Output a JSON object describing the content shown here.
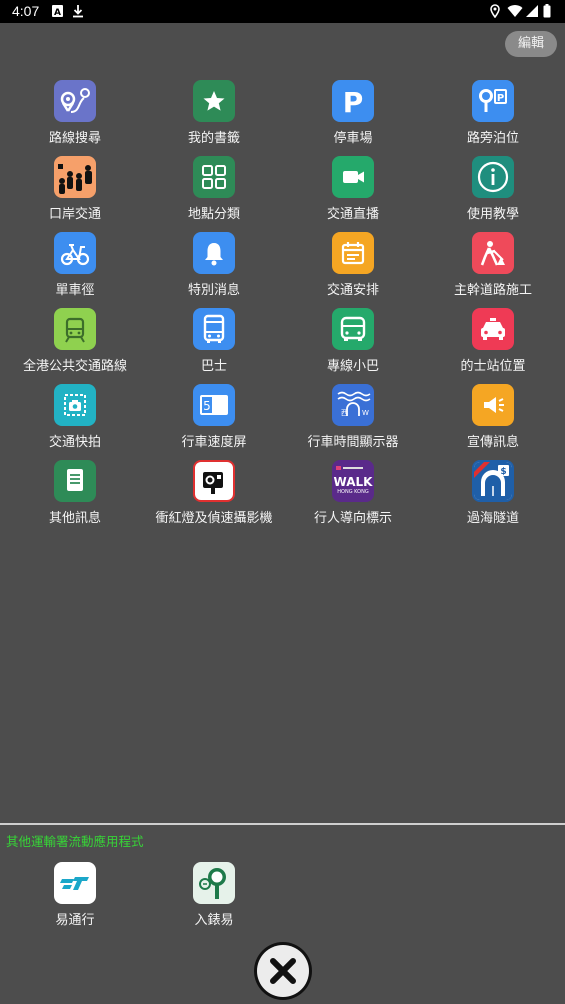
{
  "status_bar": {
    "time": "4:07"
  },
  "edit_label": "編輯",
  "main_items": [
    {
      "label": "路線搜尋",
      "icon": "route-search-icon",
      "color": "#6a74c9"
    },
    {
      "label": "我的書籤",
      "icon": "star-icon",
      "color": "#2e8b57"
    },
    {
      "label": "停車場",
      "icon": "parking-icon",
      "color": "#3d8ef0"
    },
    {
      "label": "路旁泊位",
      "icon": "parking-meter-icon",
      "color": "#3d8ef0"
    },
    {
      "label": "口岸交通",
      "icon": "border-crossing-icon",
      "color": "#f6a06a"
    },
    {
      "label": "地點分類",
      "icon": "category-grid-icon",
      "color": "#2e8b57"
    },
    {
      "label": "交通直播",
      "icon": "video-camera-icon",
      "color": "#25a96b"
    },
    {
      "label": "使用教學",
      "icon": "info-icon",
      "color": "#1f8e7e"
    },
    {
      "label": "單車徑",
      "icon": "bicycle-icon",
      "color": "#3d8ef0"
    },
    {
      "label": "特別消息",
      "icon": "bell-icon",
      "color": "#3d8ef0"
    },
    {
      "label": "交通安排",
      "icon": "calendar-icon",
      "color": "#f5a623"
    },
    {
      "label": "主幹道路施工",
      "icon": "road-works-icon",
      "color": "#ef4a5a"
    },
    {
      "label": "全港公共交通路線",
      "icon": "train-icon",
      "color": "#8fd14f"
    },
    {
      "label": "巴士",
      "icon": "bus-icon",
      "color": "#3d8ef0"
    },
    {
      "label": "專線小巴",
      "icon": "minibus-icon",
      "color": "#25a96b"
    },
    {
      "label": "的士站位置",
      "icon": "taxi-icon",
      "color": "#ef3a55"
    },
    {
      "label": "交通快拍",
      "icon": "snapshot-camera-icon",
      "color": "#22b2c4"
    },
    {
      "label": "行車速度屏",
      "icon": "speed-screen-icon",
      "color": "#3d8ef0"
    },
    {
      "label": "行車時間顯示器",
      "icon": "journey-time-icon",
      "color": "#3a70d6"
    },
    {
      "label": "宣傳訊息",
      "icon": "megaphone-icon",
      "color": "#f5a623"
    },
    {
      "label": "其他訊息",
      "icon": "document-icon",
      "color": "#2e8b57"
    },
    {
      "label": "衝紅燈及偵速攝影機",
      "icon": "red-light-camera-icon",
      "color": "#ffffff"
    },
    {
      "label": "行人導向標示",
      "icon": "walk-hong-kong-icon",
      "color": "#5a2a8a"
    },
    {
      "label": "過海隧道",
      "icon": "harbour-tunnel-icon",
      "color": "#1f5fa8"
    }
  ],
  "walk_logo": {
    "line1": "WALK",
    "line2": "HONG KONG"
  },
  "other_apps_title": "其他運輸署流動應用程式",
  "other_apps": [
    {
      "label": "易通行",
      "icon": "hktolls-icon"
    },
    {
      "label": "入錶易",
      "icon": "hkemeter-icon"
    }
  ]
}
